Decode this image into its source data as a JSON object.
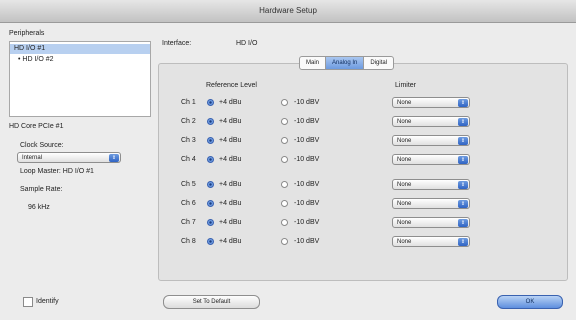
{
  "window": {
    "title": "Hardware Setup"
  },
  "peripherals": {
    "heading": "Peripherals",
    "items": [
      {
        "label": "HD I/O #1"
      },
      {
        "label": "• HD I/O #2"
      }
    ],
    "card_name": "HD Core PCIe #1"
  },
  "clock": {
    "source_label": "Clock Source:",
    "source_value": "Internal",
    "loop_master": "Loop Master: HD I/O #1",
    "sample_rate_label": "Sample Rate:",
    "sample_rate_value": "96 kHz"
  },
  "interface": {
    "label": "Interface:",
    "value": "HD I/O"
  },
  "tabs": [
    {
      "label": "Main",
      "active": false
    },
    {
      "label": "Analog In",
      "active": true
    },
    {
      "label": "Digital",
      "active": false
    }
  ],
  "columns": {
    "reference_level": "Reference Level",
    "limiter": "Limiter"
  },
  "channels": [
    {
      "label": "Ch 1",
      "opt_a": "+4 dBu",
      "opt_b": "-10 dBV",
      "selected": "a",
      "limiter": "None"
    },
    {
      "label": "Ch 2",
      "opt_a": "+4 dBu",
      "opt_b": "-10 dBV",
      "selected": "a",
      "limiter": "None"
    },
    {
      "label": "Ch 3",
      "opt_a": "+4 dBu",
      "opt_b": "-10 dBV",
      "selected": "a",
      "limiter": "None"
    },
    {
      "label": "Ch 4",
      "opt_a": "+4 dBu",
      "opt_b": "-10 dBV",
      "selected": "a",
      "limiter": "None"
    },
    {
      "label": "Ch 5",
      "opt_a": "+4 dBu",
      "opt_b": "-10 dBV",
      "selected": "a",
      "limiter": "None"
    },
    {
      "label": "Ch 6",
      "opt_a": "+4 dBu",
      "opt_b": "-10 dBV",
      "selected": "a",
      "limiter": "None"
    },
    {
      "label": "Ch 7",
      "opt_a": "+4 dBu",
      "opt_b": "-10 dBV",
      "selected": "a",
      "limiter": "None"
    },
    {
      "label": "Ch 8",
      "opt_a": "+4 dBu",
      "opt_b": "-10 dBV",
      "selected": "a",
      "limiter": "None"
    }
  ],
  "identify": {
    "label": "Identify",
    "checked": false
  },
  "buttons": {
    "set_default": "Set To Default",
    "ok": "OK"
  },
  "colors": {
    "accent": "#4f7fd6",
    "selection": "#b8d0f0"
  }
}
